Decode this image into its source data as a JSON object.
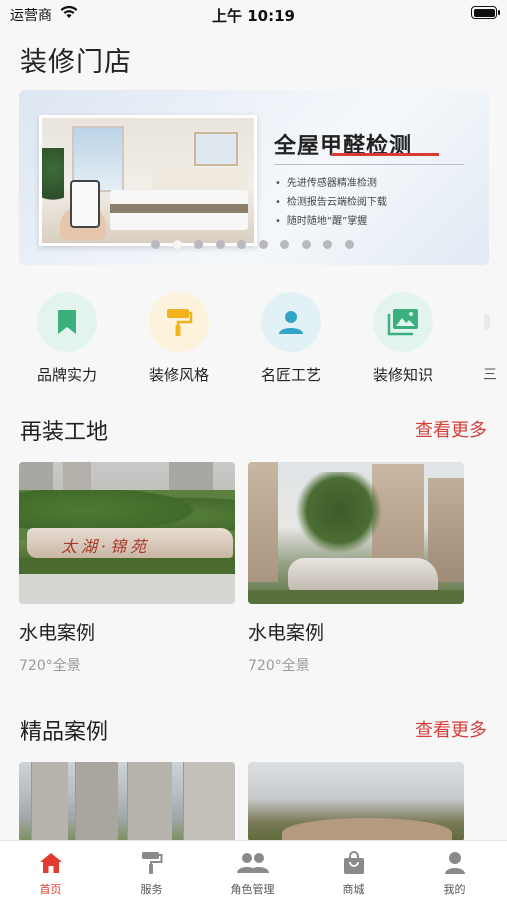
{
  "status_bar": {
    "carrier": "运营商",
    "time": "上午 10:19"
  },
  "page_title": "装修门店",
  "banner": {
    "heading": "全屋甲醛检测",
    "points": [
      "先进传感器精准检测",
      "检测报告云端检阅下载",
      "随时随地“醒”掌握"
    ],
    "dot_count": 10,
    "active_dot": 1
  },
  "categories": [
    {
      "label": "品牌实力",
      "icon": "bookmark-icon",
      "bg": "#e3f4ee",
      "color": "#3ab07c"
    },
    {
      "label": "装修风格",
      "icon": "paint-roller-icon",
      "bg": "#fdf3dc",
      "color": "#f2b21c"
    },
    {
      "label": "名匠工艺",
      "icon": "person-icon",
      "bg": "#e1f1f6",
      "color": "#2fa6c5"
    },
    {
      "label": "装修知识",
      "icon": "photo-library-icon",
      "bg": "#e3f4ee",
      "color": "#3ab07c"
    }
  ],
  "category_more_char": "三",
  "sections": {
    "sites": {
      "title": "再装工地",
      "more": "查看更多",
      "cards": [
        {
          "title": "水电案例",
          "sub": "720°全景"
        },
        {
          "title": "水电案例",
          "sub": "720°全景"
        }
      ]
    },
    "cases": {
      "title": "精品案例",
      "more": "查看更多"
    }
  },
  "photo_signs": {
    "site1_rock": "太湖·锦苑"
  },
  "tabbar": [
    {
      "label": "首页",
      "icon": "home-icon",
      "active": true
    },
    {
      "label": "服务",
      "icon": "paint-roller-icon",
      "active": false
    },
    {
      "label": "角色管理",
      "icon": "people-icon",
      "active": false
    },
    {
      "label": "商城",
      "icon": "shopping-bag-icon",
      "active": false
    },
    {
      "label": "我的",
      "icon": "user-icon",
      "active": false
    }
  ],
  "colors": {
    "accent": "#e23b32",
    "more_link": "#d53f3a",
    "inactive_icon": "#8a8a8a"
  }
}
